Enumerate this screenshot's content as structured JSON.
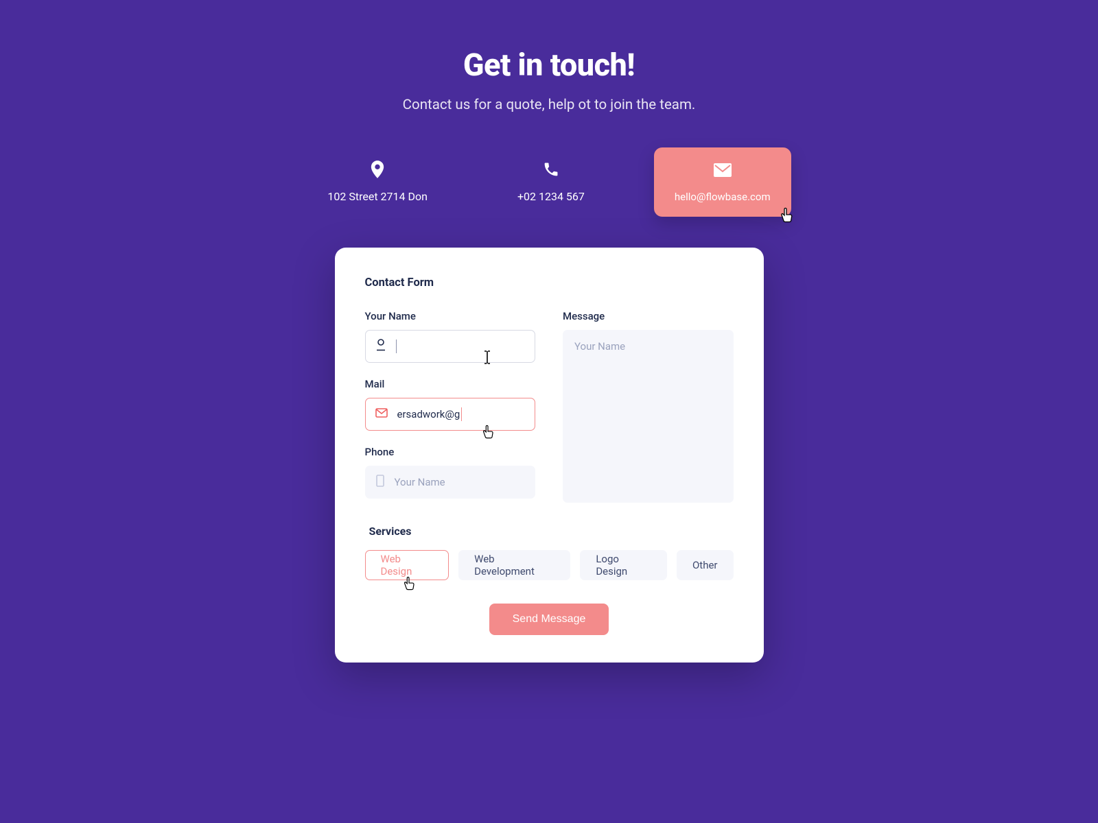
{
  "header": {
    "title": "Get in touch!",
    "subtitle": "Contact us for a quote, help ot to join the team."
  },
  "info": {
    "address": "102 Street 2714 Don",
    "phone": "+02 1234 567",
    "email": "hello@flowbase.com"
  },
  "form": {
    "title": "Contact Form",
    "name_label": "Your Name",
    "name_value": "",
    "mail_label": "Mail",
    "mail_value": "ersadwork@g",
    "phone_label": "Phone",
    "phone_placeholder": "Your Name",
    "message_label": "Message",
    "message_placeholder": "Your Name",
    "services_label": "Services",
    "services": [
      {
        "label": "Web Design",
        "selected": true
      },
      {
        "label": "Web Development",
        "selected": false
      },
      {
        "label": "Logo Design",
        "selected": false
      },
      {
        "label": "Other",
        "selected": false
      }
    ],
    "send_label": "Send Message"
  },
  "colors": {
    "bg": "#492c9b",
    "accent": "#f38b8b",
    "text_dark": "#1f2a4b",
    "muted": "#9aa2bd",
    "field_bg": "#f5f6fb"
  }
}
